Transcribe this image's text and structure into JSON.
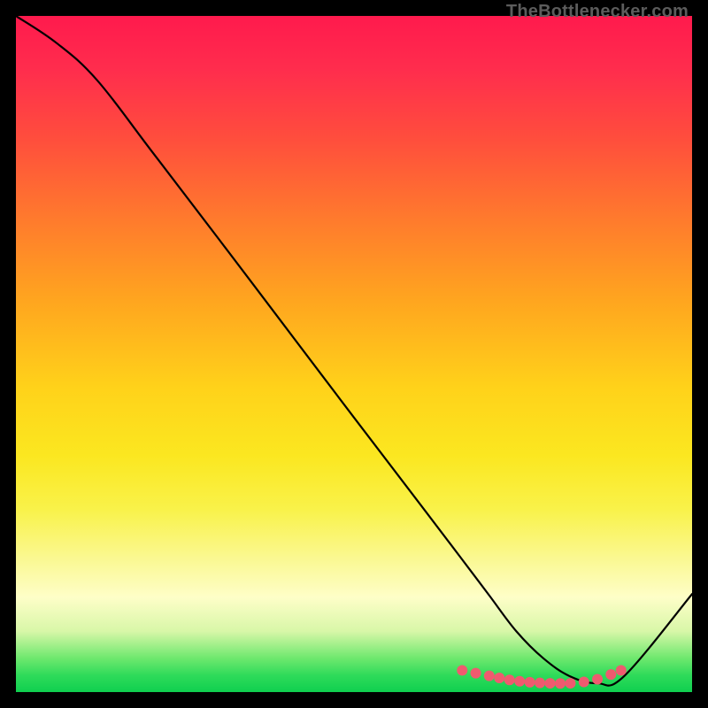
{
  "attribution": "TheBottlenecker.com",
  "chart_data": {
    "type": "line",
    "title": "",
    "xlabel": "",
    "ylabel": "",
    "xlim": [
      0,
      100
    ],
    "ylim": [
      0,
      100
    ],
    "series": [
      {
        "name": "curve",
        "x": [
          0,
          6,
          12,
          20,
          30,
          40,
          50,
          60,
          66,
          70,
          74,
          78,
          82,
          86,
          90,
          100
        ],
        "y": [
          100,
          96,
          90.5,
          80.1,
          67,
          53.8,
          40.6,
          27.5,
          19.6,
          14.3,
          9,
          5,
          2.3,
          1.3,
          2.4,
          14.5
        ]
      }
    ],
    "markers": {
      "name": "highlight-points",
      "x": [
        66,
        68,
        70,
        71.5,
        73,
        74.5,
        76,
        77.5,
        79,
        80.5,
        82,
        84,
        86,
        88,
        89.5
      ],
      "y": [
        3.2,
        2.8,
        2.4,
        2.1,
        1.8,
        1.6,
        1.45,
        1.35,
        1.3,
        1.28,
        1.3,
        1.5,
        1.9,
        2.6,
        3.2
      ],
      "color": "#ef5a6f",
      "size": 7
    },
    "gradient_stops": [
      {
        "pos": 0.0,
        "color": "#ff1a4d"
      },
      {
        "pos": 0.3,
        "color": "#ff7a2d"
      },
      {
        "pos": 0.55,
        "color": "#ffd21a"
      },
      {
        "pos": 0.8,
        "color": "#faf88f"
      },
      {
        "pos": 0.95,
        "color": "#6ee86e"
      },
      {
        "pos": 1.0,
        "color": "#0fcf4f"
      }
    ]
  }
}
